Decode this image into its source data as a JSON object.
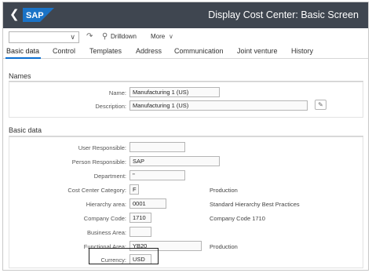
{
  "shell": {
    "back_icon": "chevron-left-icon",
    "logo_text": "SAP",
    "title": "Display Cost Center: Basic Screen"
  },
  "toolbar": {
    "variant_value": "",
    "drilldown_label": "Drilldown",
    "more_label": "More"
  },
  "tabs": [
    {
      "label": "Basic data",
      "active": true
    },
    {
      "label": "Control"
    },
    {
      "label": "Templates"
    },
    {
      "label": "Address"
    },
    {
      "label": "Communication"
    },
    {
      "label": "Joint venture"
    },
    {
      "label": "History"
    }
  ],
  "names": {
    "header": "Names",
    "name_label": "Name:",
    "name_value": "Manufacturing 1 (US)",
    "description_label": "Description:",
    "description_value": "Manufacturing 1 (US)"
  },
  "basic": {
    "header": "Basic data",
    "fields": [
      {
        "label": "User Responsible:",
        "value": "",
        "desc": ""
      },
      {
        "label": "Person Responsible:",
        "value": "SAP",
        "desc": ""
      },
      {
        "label": "Department:",
        "value": "''",
        "desc": ""
      },
      {
        "label": "Cost Center Category:",
        "value": "F",
        "desc": "Production"
      },
      {
        "label": "Hierarchy area:",
        "value": "0001",
        "desc": "Standard Hierarchy Best Practices"
      },
      {
        "label": "Company Code:",
        "value": "1710",
        "desc": "Company Code 1710"
      },
      {
        "label": "Business Area:",
        "value": "",
        "desc": ""
      },
      {
        "label": "Functional Area:",
        "value": "YB20",
        "desc": "Production"
      },
      {
        "label": "Currency:",
        "value": "USD",
        "desc": ""
      }
    ]
  },
  "colors": {
    "shell_bg": "#3f4650",
    "logo_blue": "#1a73c7",
    "tab_underline": "#0a6ed1"
  }
}
